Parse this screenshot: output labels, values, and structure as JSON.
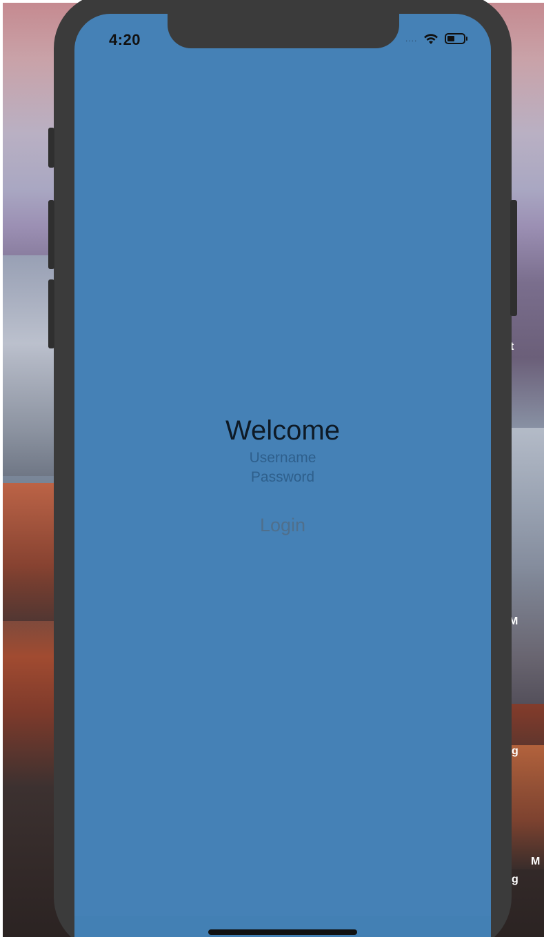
{
  "status_bar": {
    "time": "4:20",
    "signal": "....",
    "wifi_icon": "wifi-icon",
    "battery_icon": "battery-icon"
  },
  "login_screen": {
    "title": "Welcome",
    "username_placeholder": "Username",
    "password_placeholder": "Password",
    "login_label": "Login"
  },
  "desktop": {
    "labels": [
      "t",
      "M",
      "g",
      "g",
      "M"
    ]
  },
  "colors": {
    "screen_background": "#4581b6",
    "device_frame": "#3b3b3b",
    "title_text": "#0e1a26",
    "placeholder_text": "#2e5f8c",
    "button_text": "#4f6f8c"
  }
}
